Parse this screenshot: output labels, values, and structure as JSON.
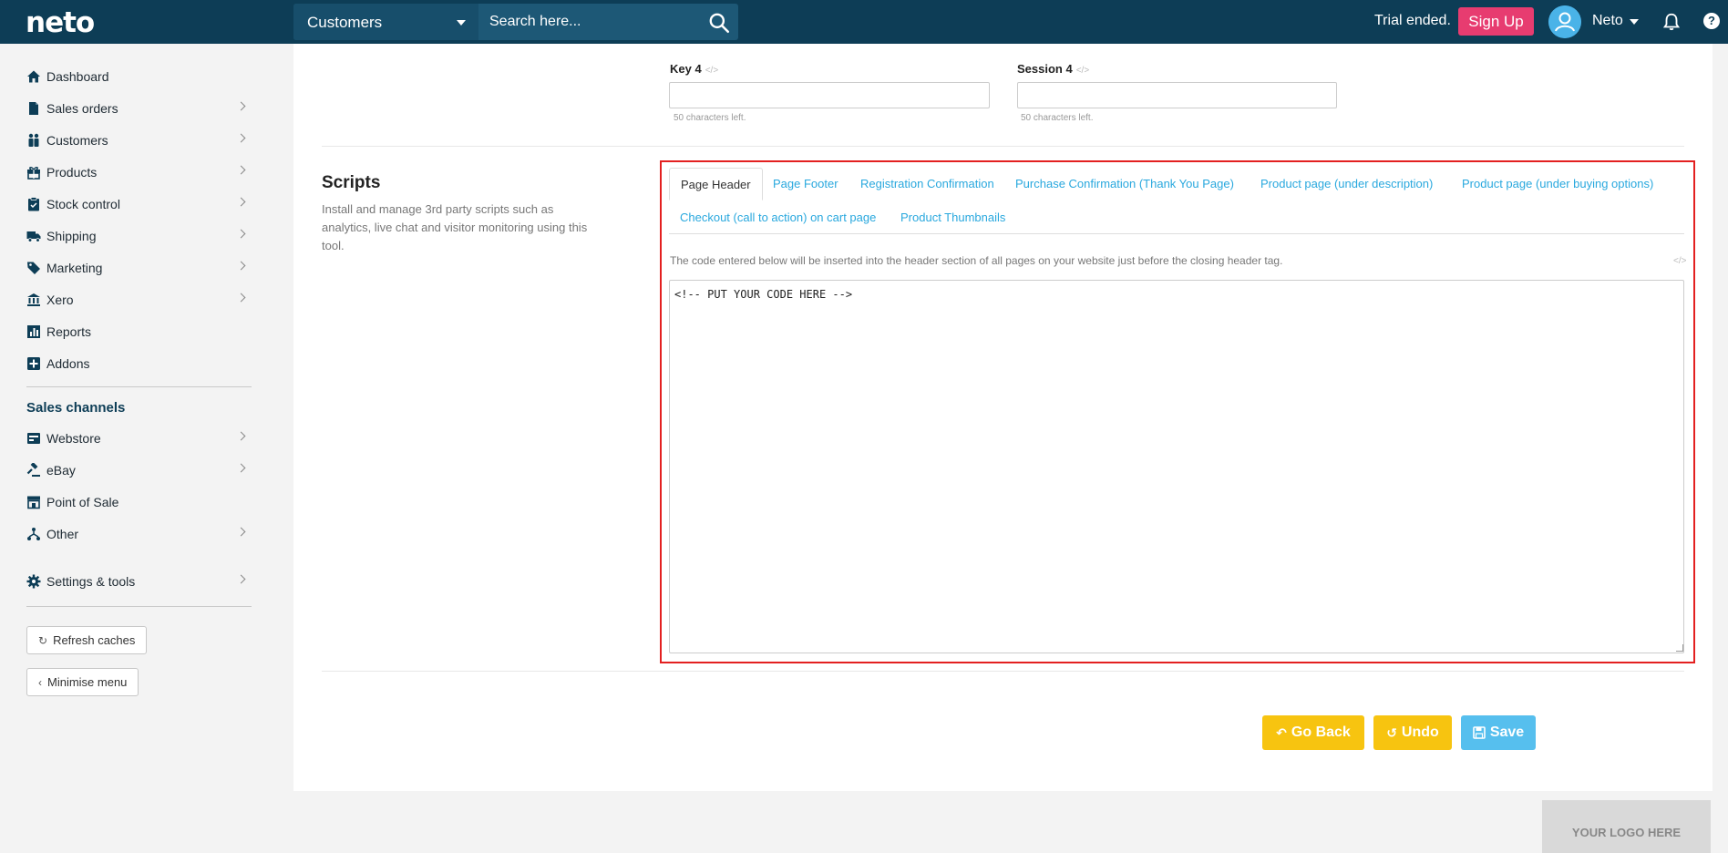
{
  "topbar": {
    "logo": "neto",
    "search_scope": "Customers",
    "search_placeholder": "Search here...",
    "trial_text": "Trial ended.",
    "signup_label": "Sign Up",
    "user_name": "Neto",
    "help_glyph": "?"
  },
  "sidebar": {
    "items": [
      {
        "label": "Dashboard",
        "icon": "home-icon"
      },
      {
        "label": "Sales orders",
        "icon": "document-icon"
      },
      {
        "label": "Customers",
        "icon": "users-icon"
      },
      {
        "label": "Products",
        "icon": "gift-icon"
      },
      {
        "label": "Stock control",
        "icon": "clipboard-icon"
      },
      {
        "label": "Shipping",
        "icon": "truck-icon"
      },
      {
        "label": "Marketing",
        "icon": "tag-icon"
      },
      {
        "label": "Xero",
        "icon": "bank-icon"
      },
      {
        "label": "Reports",
        "icon": "bar-chart-icon"
      },
      {
        "label": "Addons",
        "icon": "plus-square-icon"
      }
    ],
    "sales_channels_heading": "Sales channels",
    "channels": [
      {
        "label": "Webstore",
        "icon": "storefront-icon"
      },
      {
        "label": "eBay",
        "icon": "gavel-icon"
      },
      {
        "label": "Point of Sale",
        "icon": "store-icon"
      },
      {
        "label": "Other",
        "icon": "network-icon"
      }
    ],
    "settings_label": "Settings & tools",
    "refresh_label": "Refresh caches",
    "minimise_label": "Minimise menu"
  },
  "fields": {
    "key4_label": "Key 4",
    "session4_label": "Session 4",
    "key4_help": "50 characters left.",
    "session4_help": "50 characters left.",
    "key4_value": "",
    "session4_value": ""
  },
  "scripts": {
    "title": "Scripts",
    "description": "Install and manage 3rd party scripts such as analytics, live chat and visitor monitoring using this tool.",
    "tabs": [
      "Page Header",
      "Page Footer",
      "Registration Confirmation",
      "Purchase Confirmation (Thank You Page)",
      "Product page (under description)",
      "Product page (under buying options)",
      "Checkout (call to action) on cart page",
      "Product Thumbnails"
    ],
    "active_tab": "Page Header",
    "code_description": "The code entered below will be inserted into the header section of all pages on your website just before the closing header tag.",
    "code_value": "<!-- PUT YOUR CODE HERE -->"
  },
  "actions": {
    "go_back": "Go Back",
    "undo": "Undo",
    "save": "Save"
  },
  "footer": {
    "logo_placeholder": "YOUR LOGO HERE"
  },
  "colors": {
    "topbar": "#0d3d56",
    "signup": "#e73c70",
    "link": "#29a8de",
    "warning_button": "#f7c410",
    "save_button": "#56bfee",
    "highlight_border": "#e32020"
  }
}
